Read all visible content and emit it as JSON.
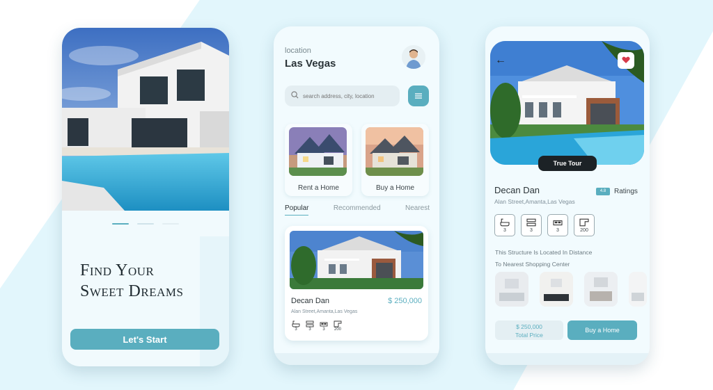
{
  "colors": {
    "accent": "#5aaebf",
    "dark": "#1c2226",
    "background": "#e2f6fc"
  },
  "onboarding": {
    "title_line1": "Find Your",
    "title_line2": "Sweet Dreams",
    "start_label": "Let's Start",
    "pager_active_index": 0,
    "pager_count": 3
  },
  "home": {
    "location_label": "location",
    "city": "Las Vegas",
    "search_placeholder": "search address, city, location",
    "categories": [
      {
        "label": "Rent a Home"
      },
      {
        "label": "Buy a Home"
      }
    ],
    "tabs": [
      {
        "label": "Popular",
        "active": true
      },
      {
        "label": "Recommended",
        "active": false
      },
      {
        "label": "Nearest",
        "active": false
      }
    ],
    "listing": {
      "name": "Decan Dan",
      "price": "$ 250,000",
      "address": "Alan Street,Amanta,Las Vegas",
      "amenities": [
        {
          "icon": "bathtub-icon",
          "value": "3"
        },
        {
          "icon": "bunk-bed-icon",
          "value": "3"
        },
        {
          "icon": "bed-icon",
          "value": "3"
        },
        {
          "icon": "area-icon",
          "value": "200"
        }
      ]
    }
  },
  "detail": {
    "tour_label": "True Tour",
    "name": "Decan Dan",
    "address": "Alan Street,Amanta,Las Vegas",
    "rating_value": "4.8",
    "rating_label": "Ratings",
    "amenities": [
      {
        "icon": "bathtub-icon",
        "value": "3"
      },
      {
        "icon": "bunk-bed-icon",
        "value": "3"
      },
      {
        "icon": "bed-icon",
        "value": "3"
      },
      {
        "icon": "area-icon",
        "value": "200"
      }
    ],
    "description_line1": "This Structure Is Located In Distance",
    "description_line2": "To Nearest Shopping Center",
    "price_value": "$ 250,000",
    "price_label": "Total Price",
    "buy_label": "Buy a Home"
  }
}
